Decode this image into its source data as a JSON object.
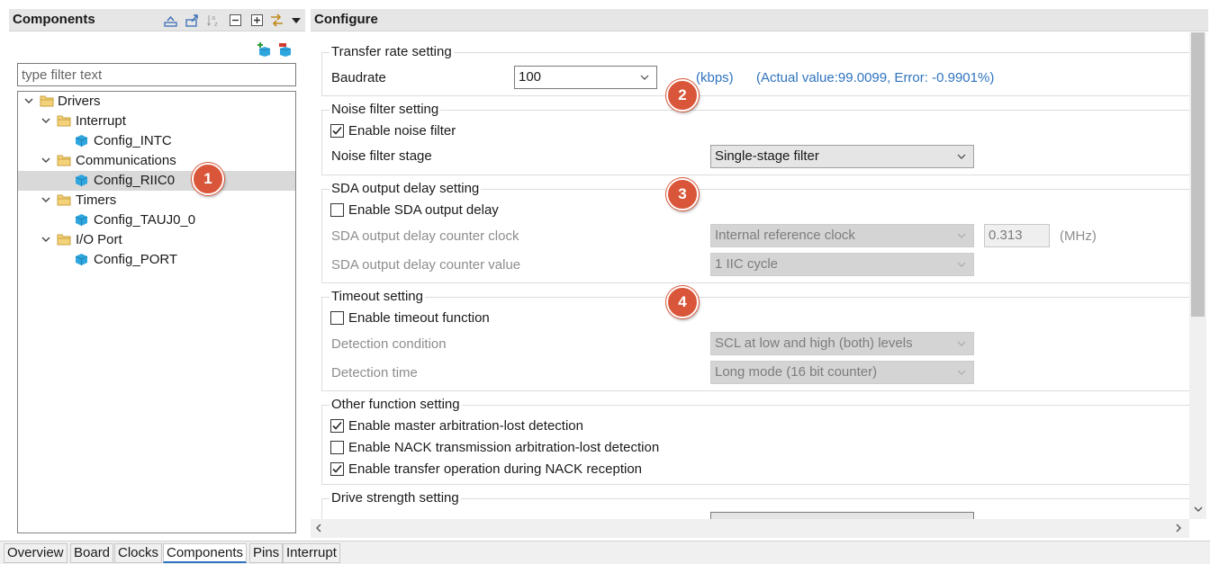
{
  "left_panel": {
    "title": "Components",
    "filter_placeholder": "type filter text",
    "tree": [
      {
        "label": "Drivers",
        "kind": "folder"
      },
      {
        "label": "Interrupt",
        "kind": "folder"
      },
      {
        "label": "Config_INTC",
        "kind": "component"
      },
      {
        "label": "Communications",
        "kind": "folder"
      },
      {
        "label": "Config_RIIC0",
        "kind": "component",
        "selected": true
      },
      {
        "label": "Timers",
        "kind": "folder"
      },
      {
        "label": "Config_TAUJ0_0",
        "kind": "component"
      },
      {
        "label": "I/O Port",
        "kind": "folder"
      },
      {
        "label": "Config_PORT",
        "kind": "component"
      }
    ]
  },
  "right_panel": {
    "title": "Configure",
    "transfer_rate": {
      "group_title": "Transfer rate setting",
      "baudrate_label": "Baudrate",
      "baudrate_value": "100",
      "unit": "(kbps)",
      "actual": "(Actual value:99.0099, Error: -0.9901%)"
    },
    "noise_filter": {
      "group_title": "Noise filter setting",
      "enable_label": "Enable noise filter",
      "enable_checked": true,
      "stage_label": "Noise filter stage",
      "stage_value": "Single-stage filter"
    },
    "sda_delay": {
      "group_title": "SDA output delay setting",
      "enable_label": "Enable SDA output delay",
      "enable_checked": false,
      "clock_label": "SDA output delay counter clock",
      "clock_value": "Internal reference clock",
      "clock_freq": "0.313",
      "clock_unit": "(MHz)",
      "counter_label": "SDA output delay counter value",
      "counter_value": "1 IIC cycle"
    },
    "timeout": {
      "group_title": "Timeout setting",
      "enable_label": "Enable timeout function",
      "enable_checked": false,
      "condition_label": "Detection condition",
      "condition_value": "SCL at low and high (both) levels",
      "time_label": "Detection time",
      "time_value": "Long mode (16 bit counter)"
    },
    "other": {
      "group_title": "Other function setting",
      "items": [
        {
          "label": "Enable master arbitration-lost detection",
          "checked": true
        },
        {
          "label": "Enable NACK transmission arbitration-lost detection",
          "checked": false
        },
        {
          "label": "Enable transfer operation during NACK reception",
          "checked": true
        }
      ]
    },
    "drive_strength": {
      "group_title": "Drive strength setting"
    }
  },
  "badges": [
    "1",
    "2",
    "3",
    "4"
  ],
  "tabs": [
    "Overview",
    "Board",
    "Clocks",
    "Components",
    "Pins",
    "Interrupt"
  ],
  "active_tab": "Components",
  "colors": {
    "accent": "#2f74c0",
    "badge": "#d9563a",
    "selection": "#d9d9d9"
  }
}
